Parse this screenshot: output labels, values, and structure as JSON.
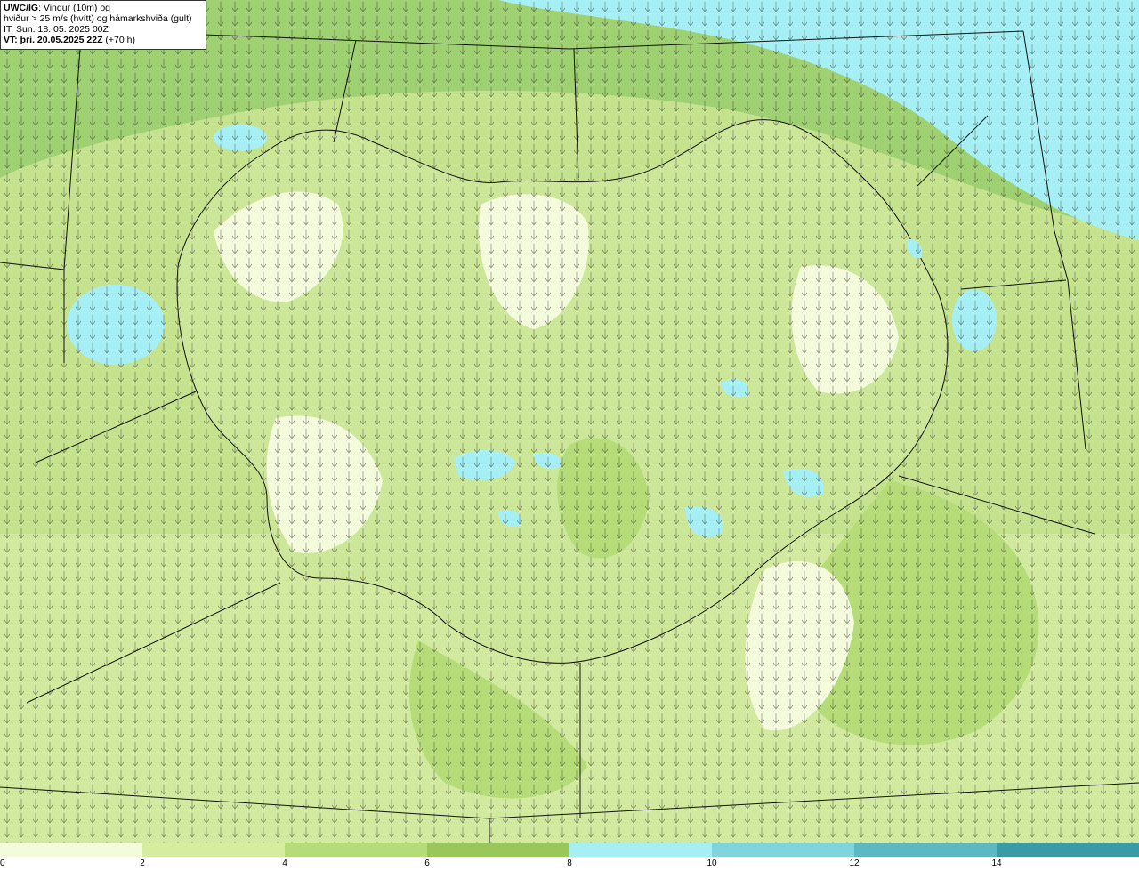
{
  "info": {
    "model": "UWC/IG",
    "line1_rest": ": Vindur (10m) og",
    "line2": "hviður > 25 m/s (hvítt) og hámarkshviða (gult)",
    "it": "IT: Sun. 18. 05. 2025 00Z",
    "vt_bold": "VT: þri. 20.05.2025 22Z",
    "vt_rest": " (+70 h)"
  },
  "legend": {
    "ticks": [
      "0",
      "2",
      "4",
      "6",
      "8",
      "10",
      "12",
      "14"
    ],
    "colors": [
      "#f4fadc",
      "#d6ec9e",
      "#b6dc7a",
      "#98c85a",
      "#a6f0f5",
      "#7fd5db",
      "#5cb9c2",
      "#3a9aa6"
    ]
  },
  "map": {
    "land_color": "#cde79a",
    "calm_color": "#f4fadc",
    "ocean_color": "#9fd67c",
    "strong_wind_color": "#a6f0f5",
    "coastline_color": "#111111",
    "arrow_color": "#333333"
  }
}
